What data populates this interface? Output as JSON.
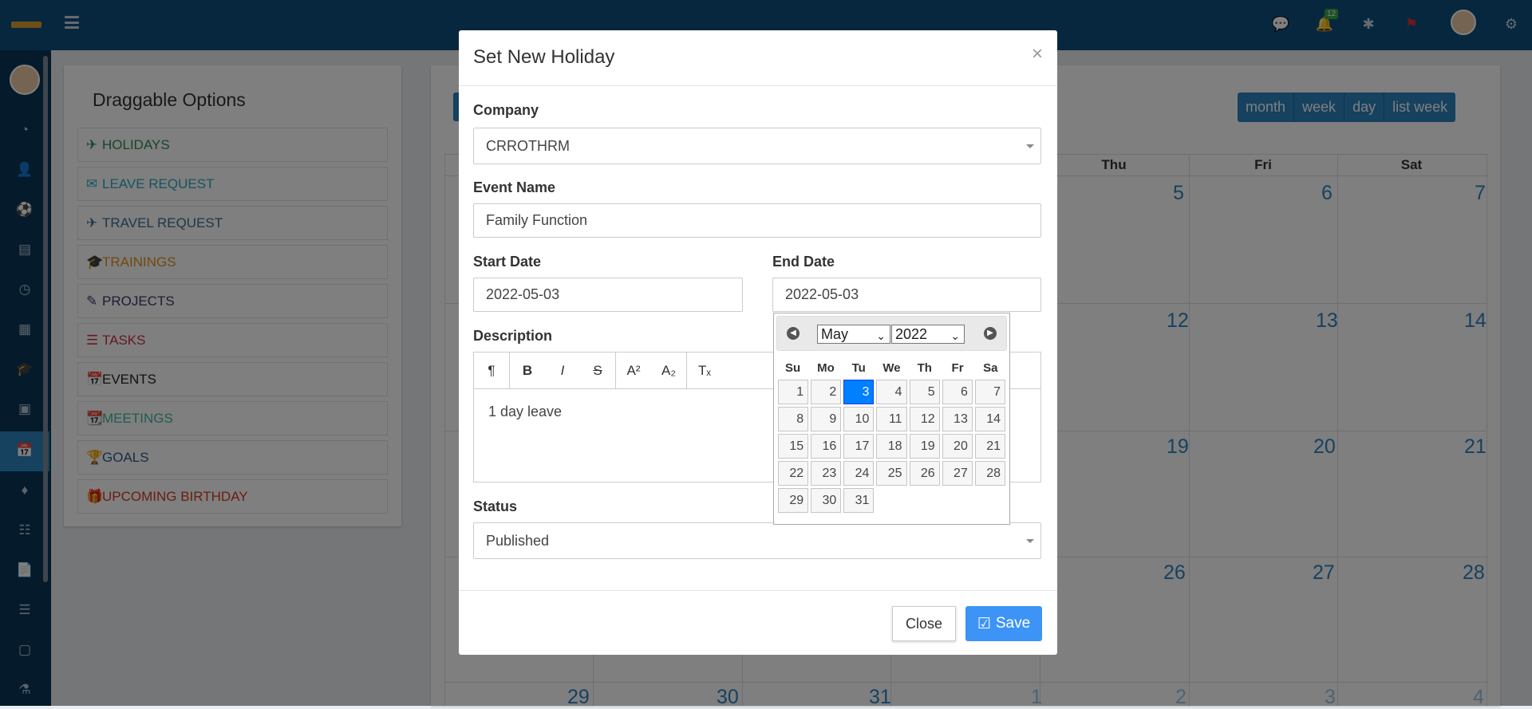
{
  "topbar": {
    "icons": [
      "menu-icon",
      "chat-icon",
      "bell-icon",
      "asterisk-icon",
      "flag-icon",
      "settings-icon"
    ],
    "notif_count": "12"
  },
  "sidebar": {
    "icons": [
      "dashboard-icon",
      "user-icon",
      "soccer-icon",
      "building-icon",
      "clock-icon",
      "calculator-icon",
      "graduation-icon",
      "box-icon",
      "calendar-icon",
      "ticket-icon",
      "newspaper-icon",
      "file-icon",
      "server-icon",
      "money-icon",
      "flask-icon"
    ]
  },
  "draggable": {
    "title": "Draggable Options",
    "items": [
      {
        "label": "HOLIDAYS",
        "icon": "plane-icon",
        "color": "#2e8b57"
      },
      {
        "label": "LEAVE REQUEST",
        "icon": "envelope-icon",
        "color": "#2aa8c4"
      },
      {
        "label": "TRAVEL REQUEST",
        "icon": "plane-icon",
        "color": "#3a6f8f"
      },
      {
        "label": "TRAININGS",
        "icon": "graduation-icon",
        "color": "#e0921c"
      },
      {
        "label": "PROJECTS",
        "icon": "edit-icon",
        "color": "#3b3b6b"
      },
      {
        "label": "TASKS",
        "icon": "tasks-icon",
        "color": "#c9324a"
      },
      {
        "label": "EVENTS",
        "icon": "calendar-plus-icon",
        "color": "#222222"
      },
      {
        "label": "MEETINGS",
        "icon": "calendar-check-icon",
        "color": "#3bb8a0"
      },
      {
        "label": "GOALS",
        "icon": "trophy-icon",
        "color": "#2e5c8a"
      },
      {
        "label": "UPCOMING BIRTHDAY",
        "icon": "gift-icon",
        "color": "#d23a2a"
      }
    ]
  },
  "calendar": {
    "views": [
      "month",
      "week",
      "day",
      "list week"
    ],
    "day_headers": [
      "Thu",
      "Fri",
      "Sat"
    ],
    "day_numbers": [
      "5",
      "6",
      "7",
      "12",
      "13",
      "14",
      "19",
      "20",
      "21",
      "26",
      "27",
      "28",
      "29",
      "30",
      "31",
      "1",
      "2",
      "3",
      "4"
    ]
  },
  "modal": {
    "title": "Set New Holiday",
    "close_symbol": "×",
    "company_label": "Company",
    "company_value": "CRROTHRM",
    "event_label": "Event Name",
    "event_value": "Family Function",
    "start_label": "Start Date",
    "start_value": "2022-05-03",
    "end_label": "End Date",
    "end_value": "2022-05-03",
    "desc_label": "Description",
    "desc_value": "1 day leave",
    "toolbar": [
      "¶",
      "B",
      "I",
      "S",
      "A²",
      "A₂",
      "Tₓ"
    ],
    "status_label": "Status",
    "status_value": "Published",
    "close_btn": "Close",
    "save_btn": "Save"
  },
  "datepicker": {
    "month": "May",
    "year": "2022",
    "weekdays": [
      "Su",
      "Mo",
      "Tu",
      "We",
      "Th",
      "Fr",
      "Sa"
    ],
    "days": [
      "1",
      "2",
      "3",
      "4",
      "5",
      "6",
      "7",
      "8",
      "9",
      "10",
      "11",
      "12",
      "13",
      "14",
      "15",
      "16",
      "17",
      "18",
      "19",
      "20",
      "21",
      "22",
      "23",
      "24",
      "25",
      "26",
      "27",
      "28",
      "29",
      "30",
      "31"
    ],
    "selected": "3"
  }
}
